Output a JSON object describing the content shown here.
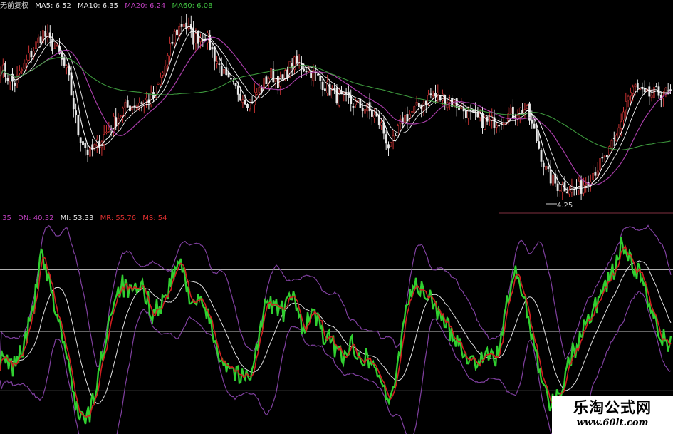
{
  "legend_top": [
    {
      "label": "无前复权",
      "color": "#cfcfcf"
    },
    {
      "label": "MA5: 6.52",
      "color": "#e8e8e8"
    },
    {
      "label": "MA10: 6.35",
      "color": "#e8e8e8"
    },
    {
      "label": "MA20: 6.24",
      "color": "#c040c0"
    },
    {
      "label": "MA60: 6.08",
      "color": "#40c040"
    }
  ],
  "legend_bottom": [
    {
      "label": ".35",
      "color": "#c040c0"
    },
    {
      "label": "DN: 40.32",
      "color": "#c040c0"
    },
    {
      "label": "MI: 53.33",
      "color": "#e8e8e8"
    },
    {
      "label": "MR: 55.76",
      "color": "#e03030"
    },
    {
      "label": "MS: 54",
      "color": "#e03030"
    }
  ],
  "low_price_label": "4.25",
  "watermark": {
    "title": "乐淘公式网",
    "url": "www.60lt.com"
  },
  "colors": {
    "background": "#000000",
    "candle_up": "#c83232",
    "candle_down": "#e8e8e8",
    "ma5": "#ffffff",
    "ma10": "#ffffff",
    "ma20": "#b040b0",
    "ma60": "#40a040",
    "osc_main": "#30d030",
    "osc_signal": "#d02020",
    "osc_mid": "#e0e0e0",
    "band": "#8040a0",
    "hline": "#c8c8c8"
  },
  "chart_data": [
    {
      "type": "candlestick",
      "ma_periods": [
        5,
        10,
        20,
        60
      ],
      "ylim": [
        4.1,
        7.15
      ],
      "lowest_low": 4.25,
      "close_path": [
        [
          0,
          6.25
        ],
        [
          20,
          6.0
        ],
        [
          38,
          6.35
        ],
        [
          60,
          6.78
        ],
        [
          80,
          6.5
        ],
        [
          95,
          6.15
        ],
        [
          110,
          5.25
        ],
        [
          125,
          4.92
        ],
        [
          140,
          5.12
        ],
        [
          160,
          5.42
        ],
        [
          175,
          5.62
        ],
        [
          195,
          5.72
        ],
        [
          215,
          5.78
        ],
        [
          230,
          6.2
        ],
        [
          245,
          6.75
        ],
        [
          258,
          6.95
        ],
        [
          272,
          6.68
        ],
        [
          288,
          6.75
        ],
        [
          300,
          6.45
        ],
        [
          318,
          6.05
        ],
        [
          335,
          5.88
        ],
        [
          350,
          5.72
        ],
        [
          365,
          5.92
        ],
        [
          380,
          6.15
        ],
        [
          395,
          6.0
        ],
        [
          410,
          6.32
        ],
        [
          430,
          6.25
        ],
        [
          450,
          6.05
        ],
        [
          470,
          5.82
        ],
        [
          495,
          5.7
        ],
        [
          515,
          5.62
        ],
        [
          535,
          5.38
        ],
        [
          548,
          4.98
        ],
        [
          565,
          5.45
        ],
        [
          585,
          5.62
        ],
        [
          605,
          5.82
        ],
        [
          625,
          5.78
        ],
        [
          645,
          5.65
        ],
        [
          665,
          5.48
        ],
        [
          685,
          5.4
        ],
        [
          700,
          5.45
        ],
        [
          720,
          5.55
        ],
        [
          738,
          5.62
        ],
        [
          752,
          5.2
        ],
        [
          768,
          4.62
        ],
        [
          782,
          4.45
        ],
        [
          800,
          4.42
        ],
        [
          815,
          4.4
        ],
        [
          830,
          4.62
        ],
        [
          850,
          4.85
        ],
        [
          865,
          5.15
        ],
        [
          880,
          5.78
        ],
        [
          892,
          5.95
        ],
        [
          905,
          5.8
        ],
        [
          920,
          5.85
        ],
        [
          940,
          5.85
        ]
      ]
    },
    {
      "type": "line",
      "indicator": "oscillator with bands",
      "ylim": [
        8,
        95
      ],
      "levels": [
        76,
        50,
        25
      ],
      "values": {
        "DN": 40.32,
        "MI": 53.33,
        "MR": 55.76,
        "MS": 54
      },
      "osc_path": [
        [
          0,
          38
        ],
        [
          18,
          35
        ],
        [
          35,
          45
        ],
        [
          48,
          62
        ],
        [
          58,
          82
        ],
        [
          70,
          68
        ],
        [
          82,
          55
        ],
        [
          92,
          42
        ],
        [
          102,
          25
        ],
        [
          112,
          15
        ],
        [
          122,
          12
        ],
        [
          132,
          22
        ],
        [
          145,
          42
        ],
        [
          158,
          62
        ],
        [
          170,
          70
        ],
        [
          185,
          65
        ],
        [
          200,
          68
        ],
        [
          215,
          58
        ],
        [
          228,
          62
        ],
        [
          242,
          72
        ],
        [
          252,
          80
        ],
        [
          262,
          68
        ],
        [
          275,
          62
        ],
        [
          288,
          60
        ],
        [
          300,
          48
        ],
        [
          312,
          38
        ],
        [
          325,
          35
        ],
        [
          338,
          30
        ],
        [
          350,
          32
        ],
        [
          360,
          42
        ],
        [
          372,
          60
        ],
        [
          385,
          62
        ],
        [
          398,
          58
        ],
        [
          410,
          65
        ],
        [
          425,
          52
        ],
        [
          440,
          58
        ],
        [
          455,
          48
        ],
        [
          468,
          44
        ],
        [
          480,
          40
        ],
        [
          495,
          44
        ],
        [
          510,
          40
        ],
        [
          525,
          36
        ],
        [
          538,
          28
        ],
        [
          548,
          18
        ],
        [
          558,
          35
        ],
        [
          568,
          58
        ],
        [
          580,
          70
        ],
        [
          595,
          66
        ],
        [
          610,
          62
        ],
        [
          625,
          52
        ],
        [
          640,
          48
        ],
        [
          655,
          40
        ],
        [
          668,
          36
        ],
        [
          680,
          42
        ],
        [
          695,
          36
        ],
        [
          710,
          58
        ],
        [
          722,
          75
        ],
        [
          735,
          66
        ],
        [
          748,
          48
        ],
        [
          760,
          32
        ],
        [
          772,
          20
        ],
        [
          785,
          22
        ],
        [
          798,
          38
        ],
        [
          812,
          45
        ],
        [
          825,
          56
        ],
        [
          838,
          62
        ],
        [
          850,
          70
        ],
        [
          862,
          75
        ],
        [
          872,
          86
        ],
        [
          882,
          82
        ],
        [
          892,
          76
        ],
        [
          903,
          72
        ],
        [
          915,
          56
        ],
        [
          925,
          50
        ],
        [
          935,
          45
        ],
        [
          945,
          46
        ]
      ]
    }
  ]
}
